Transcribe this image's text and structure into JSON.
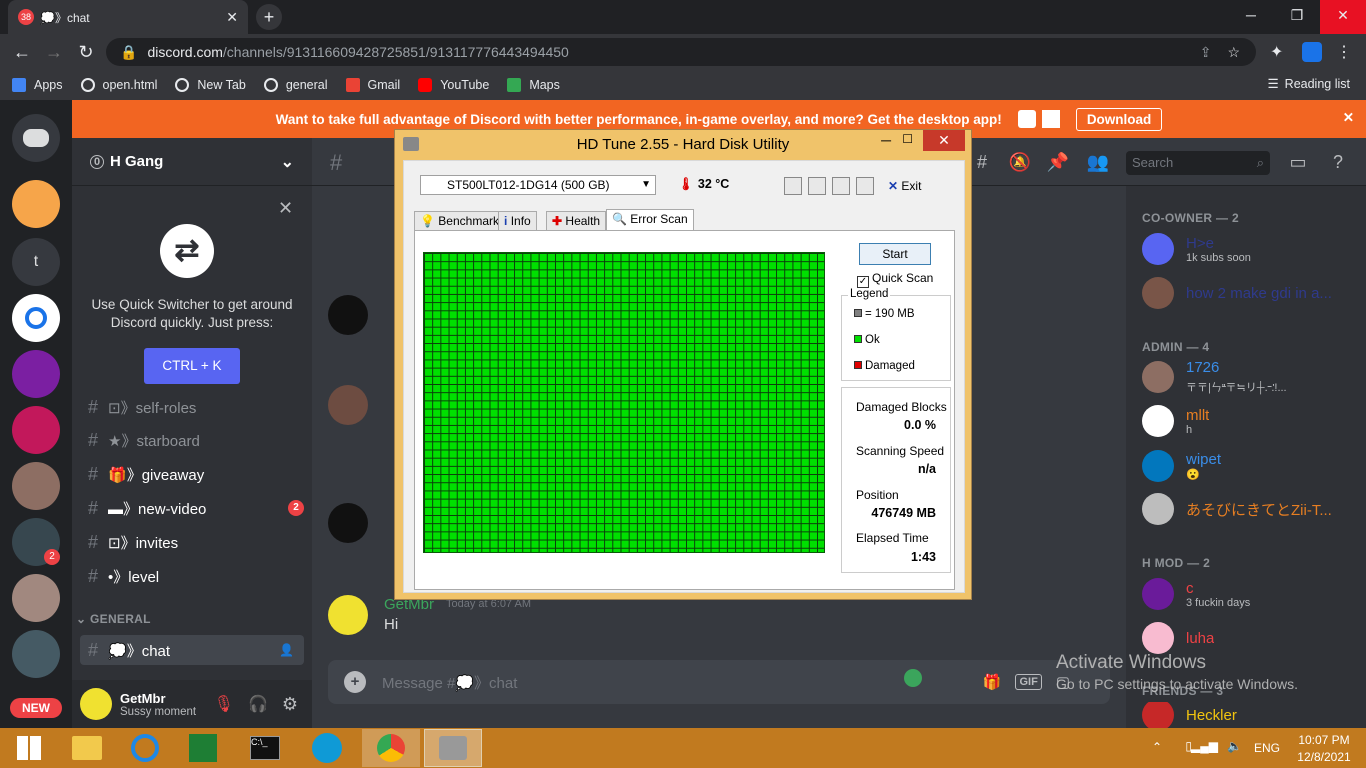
{
  "browser": {
    "tab_title": "💭》chat",
    "tab_badge": "38",
    "url_host": "discord.com",
    "url_path": "/channels/913116609428725851/913117776443494450",
    "bookmarks": [
      "Apps",
      "open.html",
      "New Tab",
      "general",
      "Gmail",
      "YouTube",
      "Maps"
    ],
    "reading_list": "Reading list"
  },
  "banner": {
    "text": "Want to take full advantage of Discord with better performance, in-game overlay, and more? Get the desktop app!",
    "download": "Download"
  },
  "guild": {
    "name": "H Gang"
  },
  "quick_switcher": {
    "message": "Use Quick Switcher to get around Discord quickly. Just press:",
    "shortcut": "CTRL + K"
  },
  "channels": [
    {
      "name": "⊡》self-roles"
    },
    {
      "name": "★》starboard"
    },
    {
      "name": "🎁》giveaway"
    },
    {
      "name": "▬》new-video",
      "badge": "2"
    },
    {
      "name": "⊡》invites"
    },
    {
      "name": "•》level"
    }
  ],
  "category_general": "GENERAL",
  "active_channel": "💭》chat",
  "user": {
    "name": "GetMbr",
    "status": "Sussy moment"
  },
  "server_badge": "2",
  "new_badge": "NEW",
  "messages": {
    "last_user": "GetMbr",
    "last_time": "Today at 6:07 AM",
    "last_text": "Hi",
    "placeholder": "Message #💭》chat"
  },
  "search_placeholder": "Search",
  "members": {
    "co_owner_label": "CO-OWNER — 2",
    "admin_label": "ADMIN — 4",
    "hmod_label": "H MOD — 2",
    "friends_label": "FRIENDS — 3",
    "list": [
      {
        "name": "H>e",
        "status": "1k subs soon",
        "color": "#2f3a8c"
      },
      {
        "name": "how 2 make gdi in a...",
        "status": "",
        "color": "#2f3a8c"
      },
      {
        "name": "1726",
        "status": "〒〒|ㄣ᠊ᡃᡃ᠊ᡃᡃ〒≒リ┼.᠊᠊.ᡃᡃ!...",
        "color": "#3a8de8"
      },
      {
        "name": "mllt",
        "status": "h",
        "color": "#e67e22"
      },
      {
        "name": "wipet",
        "status": "😮",
        "color": "#3a8de8"
      },
      {
        "name": "あそびにきてとZii-T...",
        "status": "",
        "color": "#e67e22"
      },
      {
        "name": "c",
        "status": "3 fuckin days",
        "color": "#ed4245"
      },
      {
        "name": "luha",
        "status": "",
        "color": "#ed4245"
      },
      {
        "name": "Heckler",
        "status": "",
        "color": "#f1c40f"
      }
    ]
  },
  "activate": {
    "title": "Activate Windows",
    "sub": "Go to PC settings to activate Windows."
  },
  "tray": {
    "lang": "ENG",
    "time": "10:07 PM",
    "date": "12/8/2021"
  },
  "hdtune": {
    "title": "HD Tune 2.55 - Hard Disk Utility",
    "drive": "ST500LT012-1DG14 (500 GB)",
    "temperature": "32 °C",
    "exit": "Exit",
    "tabs": [
      "Benchmark",
      "Info",
      "Health",
      "Error Scan"
    ],
    "start": "Start",
    "quick_scan": "Quick Scan",
    "legend_title": "Legend",
    "legend_block": "= 190 MB",
    "legend_ok": "Ok",
    "legend_damaged": "Damaged",
    "damaged_blocks_label": "Damaged Blocks",
    "damaged_blocks": "0.0 %",
    "scanning_speed_label": "Scanning Speed",
    "scanning_speed": "n/a",
    "position_label": "Position",
    "position": "476749 MB",
    "elapsed_label": "Elapsed Time",
    "elapsed": "1:43",
    "colors": {
      "ok": "#00e000",
      "damaged": "#e00000",
      "block": "#808080"
    }
  }
}
